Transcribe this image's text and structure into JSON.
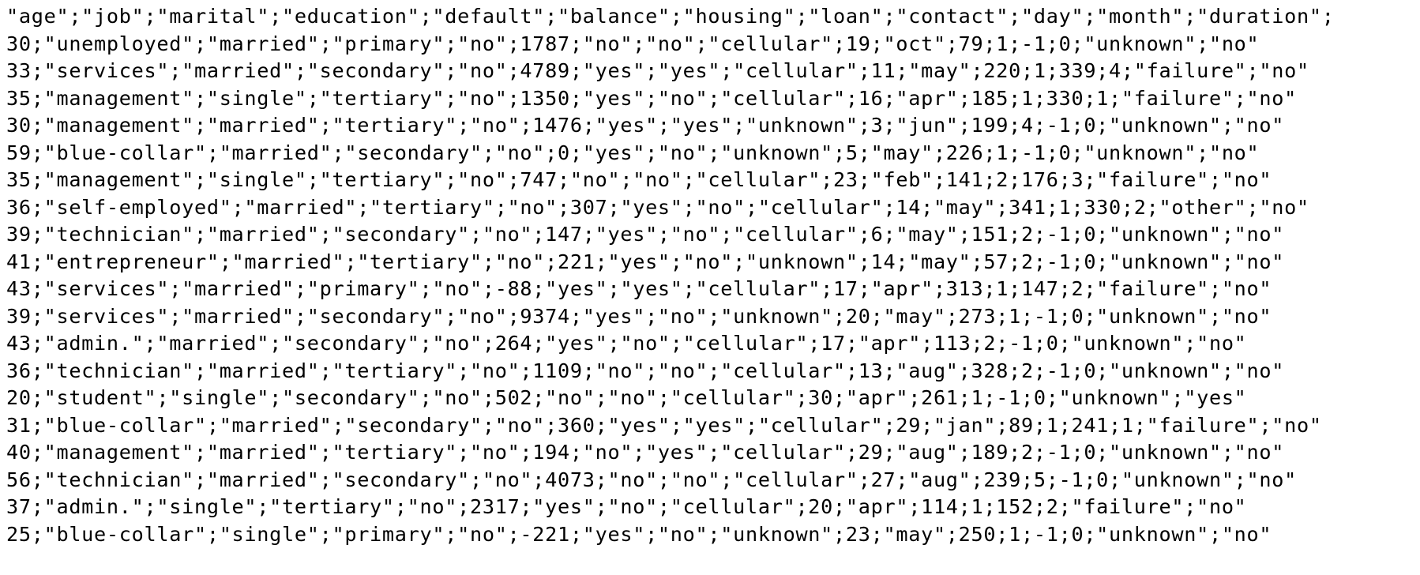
{
  "csv": {
    "delimiter": ";",
    "quote": "\"",
    "header": [
      "age",
      "job",
      "marital",
      "education",
      "default",
      "balance",
      "housing",
      "loan",
      "contact",
      "day",
      "month",
      "duration"
    ],
    "header_trailing_delimiter": true,
    "rows": [
      [
        30,
        "unemployed",
        "married",
        "primary",
        "no",
        1787,
        "no",
        "no",
        "cellular",
        19,
        "oct",
        79,
        1,
        -1,
        0,
        "unknown",
        "no"
      ],
      [
        33,
        "services",
        "married",
        "secondary",
        "no",
        4789,
        "yes",
        "yes",
        "cellular",
        11,
        "may",
        220,
        1,
        339,
        4,
        "failure",
        "no"
      ],
      [
        35,
        "management",
        "single",
        "tertiary",
        "no",
        1350,
        "yes",
        "no",
        "cellular",
        16,
        "apr",
        185,
        1,
        330,
        1,
        "failure",
        "no"
      ],
      [
        30,
        "management",
        "married",
        "tertiary",
        "no",
        1476,
        "yes",
        "yes",
        "unknown",
        3,
        "jun",
        199,
        4,
        -1,
        0,
        "unknown",
        "no"
      ],
      [
        59,
        "blue-collar",
        "married",
        "secondary",
        "no",
        0,
        "yes",
        "no",
        "unknown",
        5,
        "may",
        226,
        1,
        -1,
        0,
        "unknown",
        "no"
      ],
      [
        35,
        "management",
        "single",
        "tertiary",
        "no",
        747,
        "no",
        "no",
        "cellular",
        23,
        "feb",
        141,
        2,
        176,
        3,
        "failure",
        "no"
      ],
      [
        36,
        "self-employed",
        "married",
        "tertiary",
        "no",
        307,
        "yes",
        "no",
        "cellular",
        14,
        "may",
        341,
        1,
        330,
        2,
        "other",
        "no"
      ],
      [
        39,
        "technician",
        "married",
        "secondary",
        "no",
        147,
        "yes",
        "no",
        "cellular",
        6,
        "may",
        151,
        2,
        -1,
        0,
        "unknown",
        "no"
      ],
      [
        41,
        "entrepreneur",
        "married",
        "tertiary",
        "no",
        221,
        "yes",
        "no",
        "unknown",
        14,
        "may",
        57,
        2,
        -1,
        0,
        "unknown",
        "no"
      ],
      [
        43,
        "services",
        "married",
        "primary",
        "no",
        -88,
        "yes",
        "yes",
        "cellular",
        17,
        "apr",
        313,
        1,
        147,
        2,
        "failure",
        "no"
      ],
      [
        39,
        "services",
        "married",
        "secondary",
        "no",
        9374,
        "yes",
        "no",
        "unknown",
        20,
        "may",
        273,
        1,
        -1,
        0,
        "unknown",
        "no"
      ],
      [
        43,
        "admin.",
        "married",
        "secondary",
        "no",
        264,
        "yes",
        "no",
        "cellular",
        17,
        "apr",
        113,
        2,
        -1,
        0,
        "unknown",
        "no"
      ],
      [
        36,
        "technician",
        "married",
        "tertiary",
        "no",
        1109,
        "no",
        "no",
        "cellular",
        13,
        "aug",
        328,
        2,
        -1,
        0,
        "unknown",
        "no"
      ],
      [
        20,
        "student",
        "single",
        "secondary",
        "no",
        502,
        "no",
        "no",
        "cellular",
        30,
        "apr",
        261,
        1,
        -1,
        0,
        "unknown",
        "yes"
      ],
      [
        31,
        "blue-collar",
        "married",
        "secondary",
        "no",
        360,
        "yes",
        "yes",
        "cellular",
        29,
        "jan",
        89,
        1,
        241,
        1,
        "failure",
        "no"
      ],
      [
        40,
        "management",
        "married",
        "tertiary",
        "no",
        194,
        "no",
        "yes",
        "cellular",
        29,
        "aug",
        189,
        2,
        -1,
        0,
        "unknown",
        "no"
      ],
      [
        56,
        "technician",
        "married",
        "secondary",
        "no",
        4073,
        "no",
        "no",
        "cellular",
        27,
        "aug",
        239,
        5,
        -1,
        0,
        "unknown",
        "no"
      ],
      [
        37,
        "admin.",
        "single",
        "tertiary",
        "no",
        2317,
        "yes",
        "no",
        "cellular",
        20,
        "apr",
        114,
        1,
        152,
        2,
        "failure",
        "no"
      ],
      [
        25,
        "blue-collar",
        "single",
        "primary",
        "no",
        -221,
        "yes",
        "no",
        "unknown",
        23,
        "may",
        250,
        1,
        -1,
        0,
        "unknown",
        "no"
      ]
    ]
  }
}
